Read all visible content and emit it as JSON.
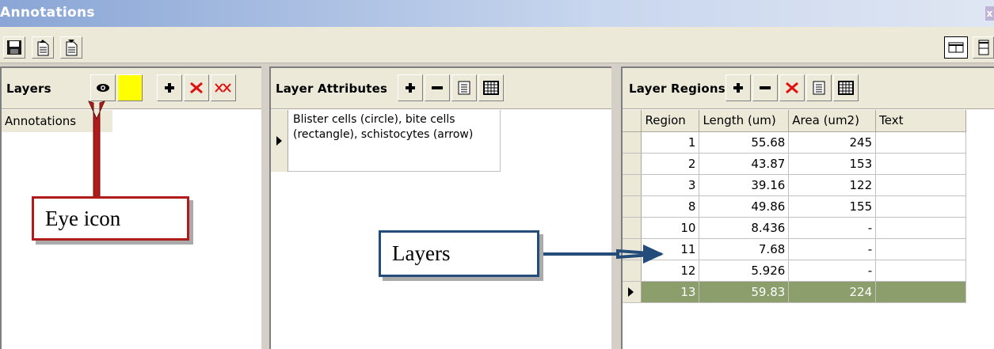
{
  "window": {
    "title": "Annotations",
    "close_glyph": "x"
  },
  "toolbar": {
    "left_buttons": [
      {
        "name": "save-icon"
      },
      {
        "name": "export-icon"
      },
      {
        "name": "import-icon"
      }
    ],
    "right_buttons": [
      {
        "name": "horizontal-layout-icon"
      },
      {
        "name": "vertical-layout-icon"
      }
    ]
  },
  "layers_panel": {
    "title": "Layers",
    "items": [
      "Annotations"
    ],
    "color_swatch": "#ffff00"
  },
  "attributes_panel": {
    "title": "Layer Attributes",
    "rows": [
      "Blister cells (circle), bite cells (rectangle), schistocytes (arrow)"
    ]
  },
  "regions_panel": {
    "title": "Layer Regions",
    "columns": [
      "Region",
      "Length (um)",
      "Area (um2)",
      "Text"
    ],
    "rows": [
      {
        "region": "1",
        "length": "55.68",
        "area": "245",
        "text": ""
      },
      {
        "region": "2",
        "length": "43.87",
        "area": "153",
        "text": ""
      },
      {
        "region": "3",
        "length": "39.16",
        "area": "122",
        "text": ""
      },
      {
        "region": "8",
        "length": "49.86",
        "area": "155",
        "text": ""
      },
      {
        "region": "10",
        "length": "8.436",
        "area": "-",
        "text": ""
      },
      {
        "region": "11",
        "length": "7.68",
        "area": "-",
        "text": ""
      },
      {
        "region": "12",
        "length": "5.926",
        "area": "-",
        "text": ""
      },
      {
        "region": "13",
        "length": "59.83",
        "area": "224",
        "text": ""
      }
    ],
    "selected_row_index": 7,
    "highlight_color": "#8c9e6c"
  },
  "callouts": {
    "eye": {
      "label": "Eye icon",
      "color": "#b01b1b"
    },
    "layers": {
      "label": "Layers",
      "color": "#244c7a"
    }
  }
}
